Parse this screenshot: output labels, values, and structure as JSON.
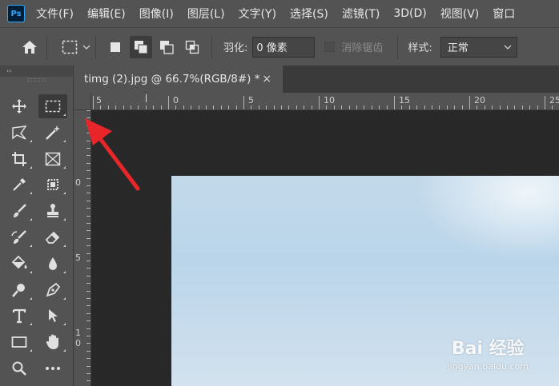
{
  "app": {
    "logo_text": "Ps"
  },
  "menu": [
    "文件(F)",
    "编辑(E)",
    "图像(I)",
    "图层(L)",
    "文字(Y)",
    "选择(S)",
    "滤镜(T)",
    "3D(D)",
    "视图(V)",
    "窗口"
  ],
  "options": {
    "feather_label": "羽化:",
    "feather_value": "0 像素",
    "antialias_label": "消除锯齿",
    "style_label": "样式:",
    "style_value": "正常"
  },
  "toolbox": {
    "collapse_glyph": "‹‹"
  },
  "document": {
    "tab_title": "timg (2).jpg @ 66.7%(RGB/8#) *",
    "close_glyph": "×"
  },
  "ruler": {
    "h_labels": [
      "5",
      "0",
      "5",
      "10",
      "15",
      "20",
      "25"
    ],
    "v_labels": [
      "0",
      "5",
      "1",
      "0"
    ]
  },
  "watermark": {
    "brand": "Bai 经验",
    "url": "jingyan.baidu.com"
  },
  "colors": {
    "menubar": "#535353",
    "canvas": "#282828",
    "accent": "#31a8ff",
    "arrow": "#e8262a"
  }
}
